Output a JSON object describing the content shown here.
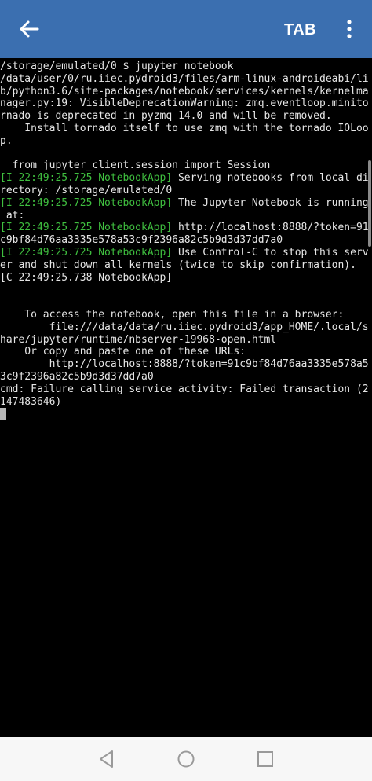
{
  "appbar": {
    "back_icon": "arrow-back-icon",
    "tab_label": "TAB",
    "menu_icon": "more-vert-icon",
    "background": "#3b6fb0"
  },
  "terminal": {
    "lines": [
      [
        {
          "t": "/storage/emulated/0 $ jupyter notebook"
        }
      ],
      [
        {
          "t": "/data/user/0/ru.iiec.pydroid3/files/arm-linux-androideabi/li"
        }
      ],
      [
        {
          "t": "b/python3.6/site-packages/notebook/services/kernels/kernelma"
        }
      ],
      [
        {
          "t": "nager.py:19: VisibleDeprecationWarning: zmq.eventloop.minito"
        }
      ],
      [
        {
          "t": "rnado is deprecated in pyzmq 14.0 and will be removed."
        }
      ],
      [
        {
          "t": "    Install tornado itself to use zmq with the tornado IOLoo"
        }
      ],
      [
        {
          "t": "p."
        }
      ],
      [
        {
          "t": ""
        }
      ],
      [
        {
          "t": "  from jupyter_client.session import Session"
        }
      ],
      [
        {
          "t": "[I 22:49:25.725 NotebookApp]",
          "c": "green"
        },
        {
          "t": " Serving notebooks from local di"
        }
      ],
      [
        {
          "t": "rectory: /storage/emulated/0"
        }
      ],
      [
        {
          "t": "[I 22:49:25.725 NotebookApp]",
          "c": "green"
        },
        {
          "t": " The Jupyter Notebook is running"
        }
      ],
      [
        {
          "t": " at:"
        }
      ],
      [
        {
          "t": "[I 22:49:25.725 NotebookApp]",
          "c": "green"
        },
        {
          "t": " http://localhost:8888/?token=91"
        }
      ],
      [
        {
          "t": "c9bf84d76aa3335e578a53c9f2396a82c5b9d3d37dd7a0"
        }
      ],
      [
        {
          "t": "[I 22:49:25.725 NotebookApp]",
          "c": "green"
        },
        {
          "t": " Use Control-C to stop this serv"
        }
      ],
      [
        {
          "t": "er and shut down all kernels (twice to skip confirmation)."
        }
      ],
      [
        {
          "t": "[C 22:49:25.738 NotebookApp]"
        }
      ],
      [
        {
          "t": ""
        }
      ],
      [
        {
          "t": ""
        }
      ],
      [
        {
          "t": "    To access the notebook, open this file in a browser:"
        }
      ],
      [
        {
          "t": "        file:///data/data/ru.iiec.pydroid3/app_HOME/.local/s"
        }
      ],
      [
        {
          "t": "hare/jupyter/runtime/nbserver-19968-open.html"
        }
      ],
      [
        {
          "t": "    Or copy and paste one of these URLs:"
        }
      ],
      [
        {
          "t": "        http://localhost:8888/?token=91c9bf84d76aa3335e578a5"
        }
      ],
      [
        {
          "t": "3c9f2396a82c5b9d3d37dd7a0"
        }
      ],
      [
        {
          "t": "cmd: Failure calling service activity: Failed transaction (2"
        }
      ],
      [
        {
          "t": "147483646)"
        }
      ]
    ],
    "text_color": "#e6e6e6",
    "log_color": "#3fbf3f"
  },
  "navbar": {
    "back_icon": "nav-back-triangle-icon",
    "home_icon": "nav-home-circle-icon",
    "recents_icon": "nav-recents-square-icon"
  }
}
